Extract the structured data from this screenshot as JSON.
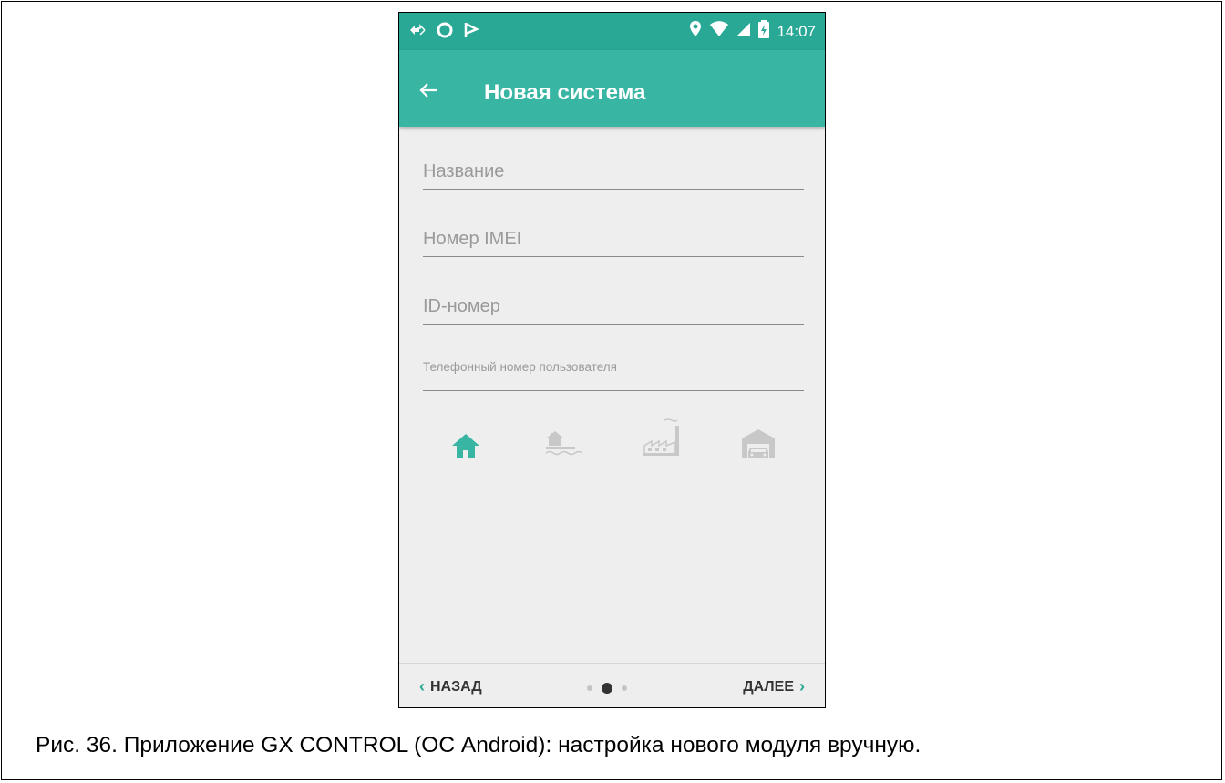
{
  "status_bar": {
    "time": "14:07",
    "left_icons": [
      "network-swap-icon",
      "circle-icon",
      "flag-icon"
    ],
    "right_icons": [
      "location-pin-icon",
      "wifi-icon",
      "signal-icon",
      "battery-icon"
    ]
  },
  "app_bar": {
    "title": "Новая система",
    "back_icon": "arrow-back-icon"
  },
  "form": {
    "fields": [
      {
        "placeholder": "Название"
      },
      {
        "placeholder": "Номер IMEI"
      },
      {
        "placeholder": "ID-номер"
      },
      {
        "placeholder": "Телефонный номер пользователя"
      }
    ],
    "object_types": [
      {
        "icon": "house-icon",
        "selected": true
      },
      {
        "icon": "lake-house-icon",
        "selected": false
      },
      {
        "icon": "factory-icon",
        "selected": false
      },
      {
        "icon": "garage-icon",
        "selected": false
      }
    ]
  },
  "bottom_nav": {
    "back_label": "НАЗАД",
    "next_label": "ДАЛЕЕ",
    "page_indicator": {
      "total": 3,
      "current": 2
    }
  },
  "colors": {
    "accent": "#38b5a3",
    "status_bar": "#2aa896",
    "background": "#eeeeee",
    "inactive_icon": "#c8c8c8"
  },
  "caption": "Рис. 36. Приложение GX CONTROL (ОС Android): настройка нового модуля вручную."
}
